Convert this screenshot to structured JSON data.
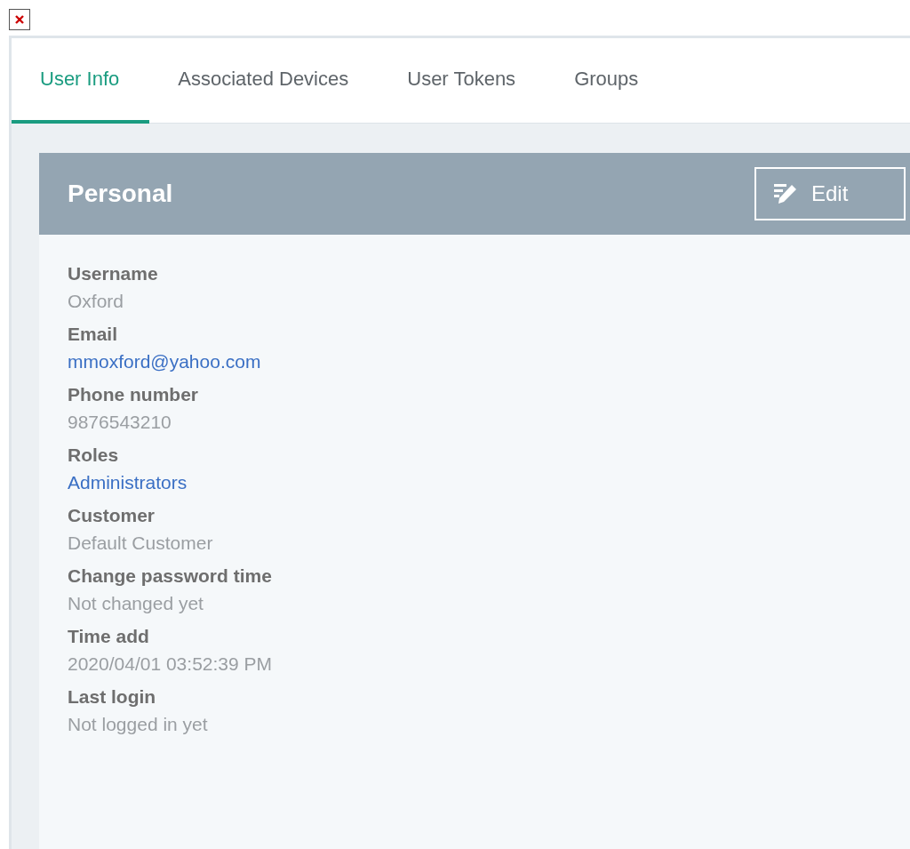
{
  "tabs": [
    {
      "label": "User Info",
      "selected": true
    },
    {
      "label": "Associated Devices",
      "selected": false
    },
    {
      "label": "User Tokens",
      "selected": false
    },
    {
      "label": "Groups",
      "selected": false
    }
  ],
  "panel": {
    "title": "Personal",
    "edit_button": "Edit"
  },
  "fields": [
    {
      "label": "Username",
      "value": "Oxford",
      "kind": "text"
    },
    {
      "label": "Email",
      "value": "mmoxford@yahoo.com",
      "kind": "link"
    },
    {
      "label": "Phone number",
      "value": "9876543210",
      "kind": "text"
    },
    {
      "label": "Roles",
      "value": "Administrators",
      "kind": "link"
    },
    {
      "label": "Customer",
      "value": "Default Customer",
      "kind": "text"
    },
    {
      "label": "Change password time",
      "value": "Not changed yet",
      "kind": "text"
    },
    {
      "label": "Time add",
      "value": "2020/04/01 03:52:39 PM",
      "kind": "text"
    },
    {
      "label": "Last login",
      "value": "Not logged in yet",
      "kind": "text"
    }
  ]
}
